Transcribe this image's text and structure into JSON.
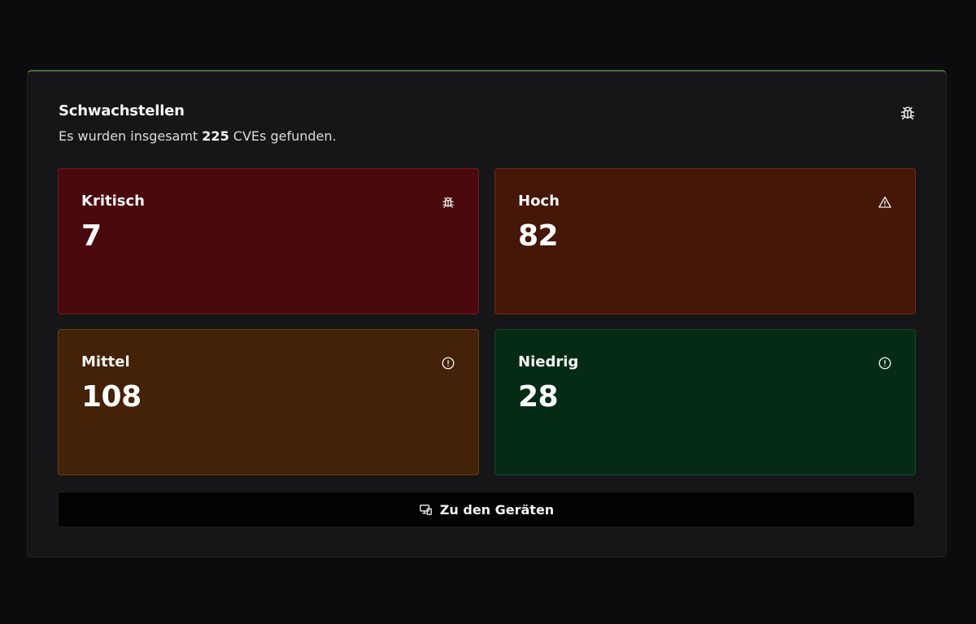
{
  "card": {
    "title": "Schwachstellen",
    "subtitle_prefix": "Es wurden insgesamt ",
    "total": "225",
    "subtitle_suffix": " CVEs gefunden.",
    "icon": "bug-icon",
    "accent_color": "#4a6b3e"
  },
  "tiles": [
    {
      "label": "Kritisch",
      "value": "7",
      "icon": "bug-icon",
      "color": "#4a0a0d"
    },
    {
      "label": "Hoch",
      "value": "82",
      "icon": "alert-triangle-icon",
      "color": "#451709"
    },
    {
      "label": "Mittel",
      "value": "108",
      "icon": "alert-circle-icon",
      "color": "#432208"
    },
    {
      "label": "Niedrig",
      "value": "28",
      "icon": "alert-circle-icon",
      "color": "#062b15"
    }
  ],
  "button": {
    "label": "Zu den Geräten",
    "icon": "devices-icon"
  }
}
